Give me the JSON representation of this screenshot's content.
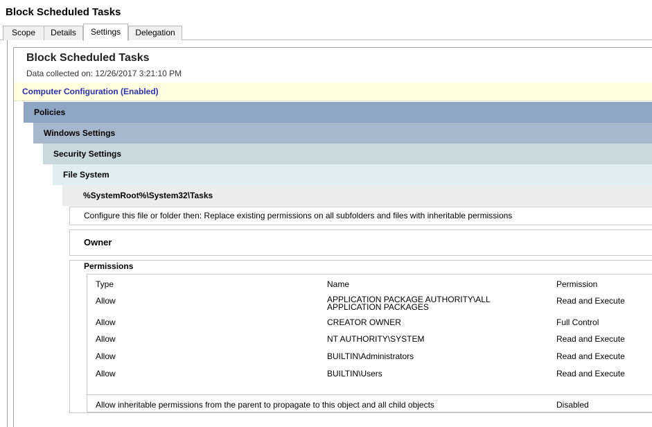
{
  "window": {
    "title": "Block Scheduled Tasks"
  },
  "tabs": [
    {
      "label": "Scope",
      "active": false
    },
    {
      "label": "Details",
      "active": false
    },
    {
      "label": "Settings",
      "active": true
    },
    {
      "label": "Delegation",
      "active": false
    }
  ],
  "report": {
    "title": "Block Scheduled Tasks",
    "data_collected": "Data collected on: 12/26/2017 3:21:10 PM",
    "computer_config": "Computer Configuration (Enabled)",
    "policies": "Policies",
    "windows_settings": "Windows Settings",
    "security_settings": "Security Settings",
    "file_system": "File System",
    "path": "%SystemRoot%\\System32\\Tasks",
    "configure": "Configure this file or folder then: Replace existing permissions on all subfolders and files with inheritable permissions",
    "owner": "Owner",
    "permissions": {
      "title": "Permissions",
      "headers": {
        "type": "Type",
        "name": "Name",
        "permission": "Permission"
      },
      "rows": [
        {
          "type": "Allow",
          "name": "APPLICATION PACKAGE AUTHORITY\\ALL\nAPPLICATION PACKAGES",
          "permission": "Read and Execute"
        },
        {
          "type": "Allow",
          "name": "CREATOR OWNER",
          "permission": "Full Control"
        },
        {
          "type": "Allow",
          "name": "NT AUTHORITY\\SYSTEM",
          "permission": "Read and Execute"
        },
        {
          "type": "Allow",
          "name": "BUILTIN\\Administrators",
          "permission": "Read and Execute"
        },
        {
          "type": "Allow",
          "name": "BUILTIN\\Users",
          "permission": "Read and Execute"
        }
      ]
    },
    "inherit": {
      "label": "Allow inheritable permissions from the parent to propagate to this object and all child objects",
      "value": "Disabled"
    }
  },
  "colors": {
    "computer_config_text": "#2a30b8",
    "policies_band": "#8fa6c6",
    "windows_band": "#a7b8cc",
    "security_band": "#c9dadc",
    "filesystem_band": "#e0eef0",
    "computer_band": "#ffffe0"
  }
}
